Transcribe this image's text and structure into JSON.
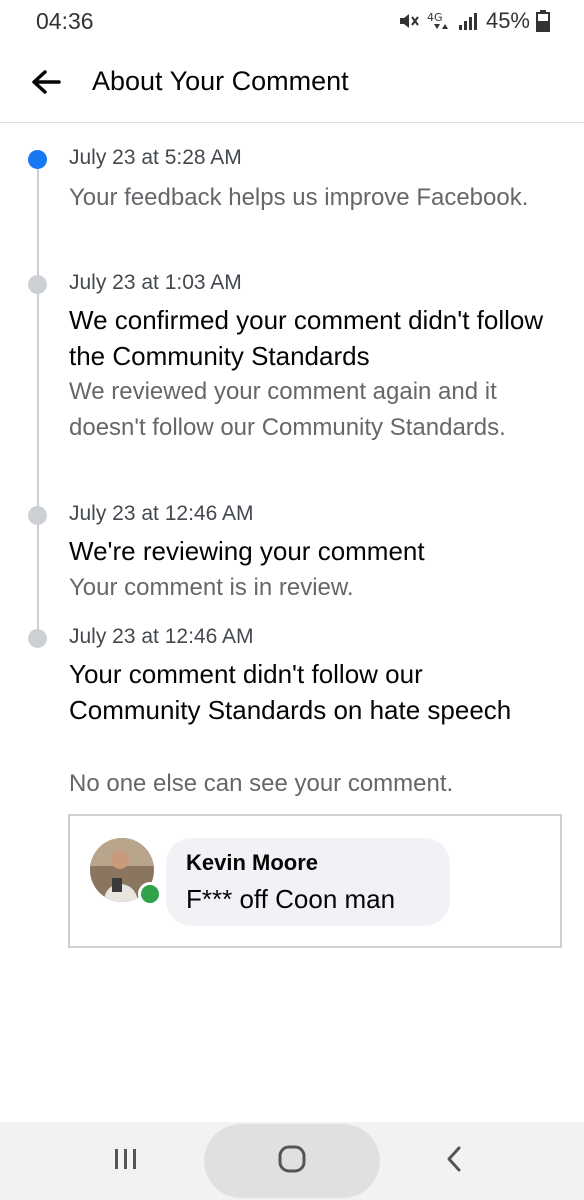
{
  "status_bar": {
    "time": "04:36",
    "battery": "45%",
    "network": "4G",
    "icons": [
      "mute-vibrate-icon",
      "lte-icon",
      "signal-icon",
      "battery-icon"
    ]
  },
  "header": {
    "title": "About Your Comment",
    "back_icon": "arrow-left-icon"
  },
  "timeline": [
    {
      "date": "July 23 at 5:28 AM",
      "title": "",
      "body": "Your feedback helps us improve Facebook.",
      "active": true
    },
    {
      "date": "July 23 at 1:03 AM",
      "title": "We confirmed your comment didn't follow the Community Standards",
      "body": "We reviewed your comment again and it doesn't follow our Community Standards.",
      "active": false
    },
    {
      "date": "July 23 at 12:46 AM",
      "title": "We're reviewing your comment",
      "body": "Your comment is in review.",
      "active": false
    },
    {
      "date": "July 23 at 12:46 AM",
      "title": "Your comment didn't follow our Community Standards on hate speech",
      "body": "No one else can see your comment.",
      "active": false
    }
  ],
  "comment": {
    "author": "Kevin Moore",
    "text": "F*** off Coon man",
    "online": true
  },
  "nav_bar": {
    "icons": [
      "recent-apps-icon",
      "home-icon",
      "back-icon"
    ]
  },
  "colors": {
    "accent": "#1877f2",
    "timeline_inactive": "#ccd0d5",
    "secondary_text": "#65676b",
    "online": "#31a24c"
  }
}
